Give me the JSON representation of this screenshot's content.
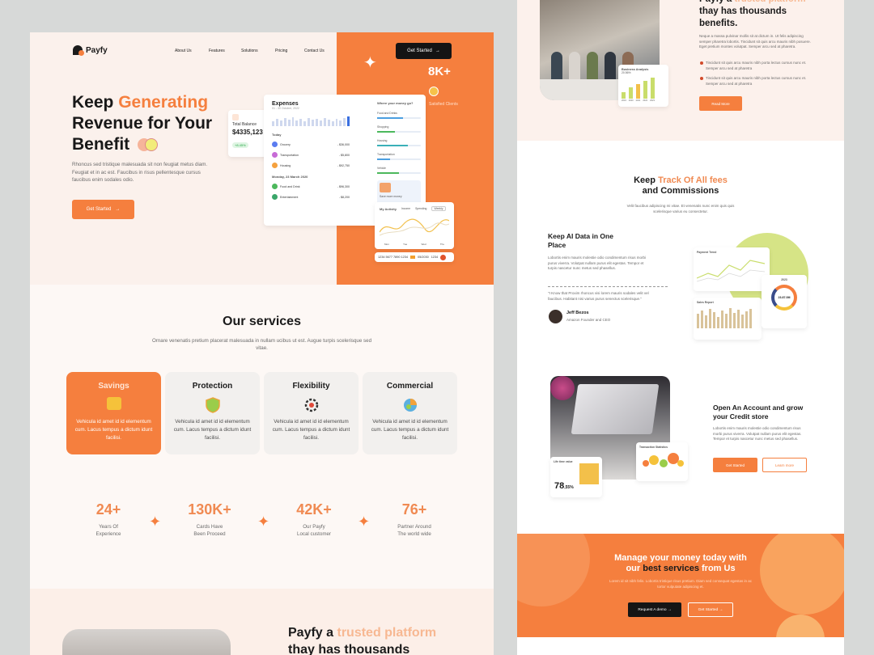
{
  "brand": {
    "name": "Payfy",
    "accent": "#f57f3e",
    "dark": "#141414"
  },
  "nav": {
    "items": [
      "About Us",
      "Features",
      "Solutions",
      "Pricing",
      "Contact Us"
    ],
    "cta": "Get Started"
  },
  "hero": {
    "title_line1_a": "Keep ",
    "title_line1_b": "Generating",
    "title_line2": "Revenue for Your",
    "title_line3": "Benefit",
    "description": "Rhoncus sed tristique malesuada sit non feugiat metus diam. Feugiat et in ac est. Faucibus in risus pellentesque cursus faucibus enim sodales odio.",
    "cta": "Get Started",
    "stat_value": "8K+",
    "stat_label": "Satisfied Clients"
  },
  "balance_card": {
    "title": "Total Balance",
    "value": "$4335,123",
    "change": "+8.45%"
  },
  "expenses_card": {
    "title": "Expenses",
    "date": "01 - 30 October, 2022",
    "today_label": "Today",
    "items": [
      {
        "name": "Grocery",
        "amount": "- $36,000",
        "color": "#5b7cf0"
      },
      {
        "name": "Transportation",
        "amount": "- $5,800",
        "color": "#c76bd6"
      },
      {
        "name": "Housing",
        "amount": "- $92,750",
        "color": "#f5a13e"
      }
    ],
    "date2_label": "Monday, 23 March 2020",
    "items2": [
      {
        "name": "Food and Drink",
        "amount": "- $96,300",
        "color": "#4cb85c"
      },
      {
        "name": "Entertainment",
        "amount": "- $8,200",
        "color": "#3aa66a"
      }
    ],
    "right_title": "Where your money go?",
    "categories": [
      "Food and Drinks",
      "Shopping",
      "Housing",
      "Transportation",
      "Vehicle"
    ],
    "save_title": "Save more money"
  },
  "activity_card": {
    "title": "My Activity",
    "legend_a": "Income",
    "legend_b": "Spending",
    "period": "Weekly",
    "axis": [
      "Mon",
      "Tue",
      "Wed",
      "Thu"
    ]
  },
  "card_strip": {
    "number": "1234 5677 7890 1234",
    "expiry": "05/2030",
    "cvv": "1234"
  },
  "services": {
    "title": "Our services",
    "description": "Ornare venenatis pretium placerat malesuada in nullam ucibus ut est. Augue turpis scelerisque sed vitae.",
    "items": [
      {
        "name": "Savings",
        "desc": "Vehicula id amet id id elementum cum. Lacus tempus a dictum idunt facilisi.",
        "icon": "wallet-icon"
      },
      {
        "name": "Protection",
        "desc": "Vehicula id amet id id elementum cum. Lacus tempus a dictum idunt facilisi.",
        "icon": "shield-icon"
      },
      {
        "name": "Flexibility",
        "desc": "Vehicula id amet id id elementum cum. Lacus tempus a dictum idunt facilisi.",
        "icon": "gear-icon"
      },
      {
        "name": "Commercial",
        "desc": "Vehicula id amet id id elementum cum. Lacus tempus a dictum idunt facilisi.",
        "icon": "pie-chart-icon"
      }
    ]
  },
  "stats": [
    {
      "value": "24+",
      "label1": "Years Of",
      "label2": "Experience"
    },
    {
      "value": "130K+",
      "label1": "Cards Have",
      "label2": "Been Proceed"
    },
    {
      "value": "42K+",
      "label1": "Our Payfy",
      "label2": "Local customer"
    },
    {
      "value": "76+",
      "label1": "Partner Around",
      "label2": "The world wide"
    }
  ],
  "trusted": {
    "line1_a": "Payfy a ",
    "line1_b": "trusted platform",
    "line2": "thay has thousands",
    "line3": "benefits.",
    "description": "Neque a massa pulvinar mollis sit at dictum in. Ut felis adipiscing semper pharetra lobortis. Tincidunt sit quis arcu mauris nibh posuere. Eget pretium montes volutpat. Semper arcu sed at pharetra.",
    "bullets": [
      "Tincidunt sit quis arcu mauris nibh porta lectus cursus nunc et. Semper arcu sed at pharetra",
      "Tincidunt sit quis arcu mauris nibh porta lectus cursus nunc et. Semper arcu sed at pharetra"
    ],
    "cta": "Read More",
    "chart_title": "Business Analysis",
    "chart_value": "20.56%",
    "chart_years": [
      "2019",
      "2020",
      "2021",
      "2022",
      "2023"
    ]
  },
  "track": {
    "title_a": "Keep ",
    "title_b": "Track Of All fees",
    "title_c": "and Commissions",
    "description": "Velit faucibus adipiscing mi vitae. Et venenatis nunc enim quis quis scelerisque varius eu consectetur."
  },
  "ai": {
    "title": "Keep AI  Data in One Place",
    "description": "Lobortis enim mauris molestie odio condimentum risus morbi purus viverra. Volutpat nullam purus elit egestas. Tempor et turpis nascetur nunc metus sed phasellus.",
    "quote": "\"I Know that Proxim rhoncus visi lorem mauris sodales velit vel faucibus. Habitant nisi varius purus senectus scelerisque.\"",
    "author": "Jeff Bezos",
    "author_role": "Amazon Founder and CEO",
    "trend_title": "Payment Trend",
    "report_title": "Sales Report",
    "donut_value": "23.87.0M",
    "donut_year": "2023"
  },
  "account": {
    "title": "Open An Account and grow your Credit store",
    "description": "Lobortis enim mauris molestie odio condimentum risus morbi purus viverra. Volutpat nullam purus elit egestas. Tempor et turpis nascetur nunc metus sed phasellus.",
    "cta_primary": "Get Started",
    "cta_secondary": "Learn more",
    "ts_title": "Transaction Statistics",
    "lt_title": "Life time value",
    "lt_value": "78",
    "lt_unit": ",55%"
  },
  "manage": {
    "line1": "Manage your money today with",
    "line2_a": "our ",
    "line2_b": "best services",
    "line2_c": " from Us",
    "description": "Lorem id sit nibh felis. Lobortis tristique risus pretium. Diam sed consequat egestas in ac tortor vulputate adipiscing et.",
    "cta_primary": "Request A demo",
    "cta_secondary": "Get Started"
  }
}
